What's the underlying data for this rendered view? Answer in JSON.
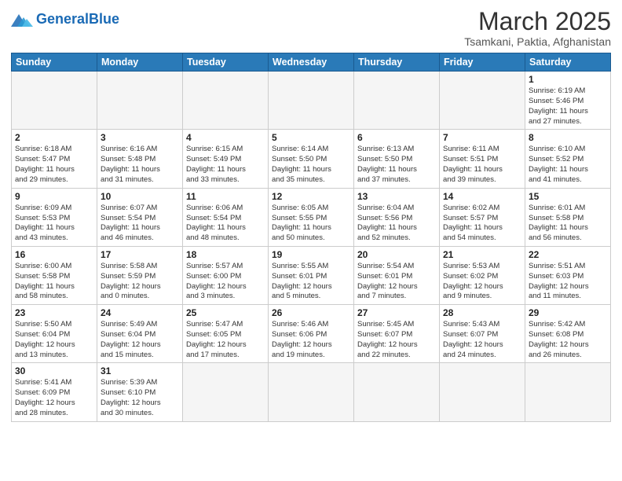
{
  "logo": {
    "general": "General",
    "blue": "Blue"
  },
  "header": {
    "month": "March 2025",
    "location": "Tsamkani, Paktia, Afghanistan"
  },
  "weekdays": [
    "Sunday",
    "Monday",
    "Tuesday",
    "Wednesday",
    "Thursday",
    "Friday",
    "Saturday"
  ],
  "weeks": [
    [
      {
        "day": "",
        "info": ""
      },
      {
        "day": "",
        "info": ""
      },
      {
        "day": "",
        "info": ""
      },
      {
        "day": "",
        "info": ""
      },
      {
        "day": "",
        "info": ""
      },
      {
        "day": "",
        "info": ""
      },
      {
        "day": "1",
        "info": "Sunrise: 6:19 AM\nSunset: 5:46 PM\nDaylight: 11 hours\nand 27 minutes."
      }
    ],
    [
      {
        "day": "2",
        "info": "Sunrise: 6:18 AM\nSunset: 5:47 PM\nDaylight: 11 hours\nand 29 minutes."
      },
      {
        "day": "3",
        "info": "Sunrise: 6:16 AM\nSunset: 5:48 PM\nDaylight: 11 hours\nand 31 minutes."
      },
      {
        "day": "4",
        "info": "Sunrise: 6:15 AM\nSunset: 5:49 PM\nDaylight: 11 hours\nand 33 minutes."
      },
      {
        "day": "5",
        "info": "Sunrise: 6:14 AM\nSunset: 5:50 PM\nDaylight: 11 hours\nand 35 minutes."
      },
      {
        "day": "6",
        "info": "Sunrise: 6:13 AM\nSunset: 5:50 PM\nDaylight: 11 hours\nand 37 minutes."
      },
      {
        "day": "7",
        "info": "Sunrise: 6:11 AM\nSunset: 5:51 PM\nDaylight: 11 hours\nand 39 minutes."
      },
      {
        "day": "8",
        "info": "Sunrise: 6:10 AM\nSunset: 5:52 PM\nDaylight: 11 hours\nand 41 minutes."
      }
    ],
    [
      {
        "day": "9",
        "info": "Sunrise: 6:09 AM\nSunset: 5:53 PM\nDaylight: 11 hours\nand 43 minutes."
      },
      {
        "day": "10",
        "info": "Sunrise: 6:07 AM\nSunset: 5:54 PM\nDaylight: 11 hours\nand 46 minutes."
      },
      {
        "day": "11",
        "info": "Sunrise: 6:06 AM\nSunset: 5:54 PM\nDaylight: 11 hours\nand 48 minutes."
      },
      {
        "day": "12",
        "info": "Sunrise: 6:05 AM\nSunset: 5:55 PM\nDaylight: 11 hours\nand 50 minutes."
      },
      {
        "day": "13",
        "info": "Sunrise: 6:04 AM\nSunset: 5:56 PM\nDaylight: 11 hours\nand 52 minutes."
      },
      {
        "day": "14",
        "info": "Sunrise: 6:02 AM\nSunset: 5:57 PM\nDaylight: 11 hours\nand 54 minutes."
      },
      {
        "day": "15",
        "info": "Sunrise: 6:01 AM\nSunset: 5:58 PM\nDaylight: 11 hours\nand 56 minutes."
      }
    ],
    [
      {
        "day": "16",
        "info": "Sunrise: 6:00 AM\nSunset: 5:58 PM\nDaylight: 11 hours\nand 58 minutes."
      },
      {
        "day": "17",
        "info": "Sunrise: 5:58 AM\nSunset: 5:59 PM\nDaylight: 12 hours\nand 0 minutes."
      },
      {
        "day": "18",
        "info": "Sunrise: 5:57 AM\nSunset: 6:00 PM\nDaylight: 12 hours\nand 3 minutes."
      },
      {
        "day": "19",
        "info": "Sunrise: 5:55 AM\nSunset: 6:01 PM\nDaylight: 12 hours\nand 5 minutes."
      },
      {
        "day": "20",
        "info": "Sunrise: 5:54 AM\nSunset: 6:01 PM\nDaylight: 12 hours\nand 7 minutes."
      },
      {
        "day": "21",
        "info": "Sunrise: 5:53 AM\nSunset: 6:02 PM\nDaylight: 12 hours\nand 9 minutes."
      },
      {
        "day": "22",
        "info": "Sunrise: 5:51 AM\nSunset: 6:03 PM\nDaylight: 12 hours\nand 11 minutes."
      }
    ],
    [
      {
        "day": "23",
        "info": "Sunrise: 5:50 AM\nSunset: 6:04 PM\nDaylight: 12 hours\nand 13 minutes."
      },
      {
        "day": "24",
        "info": "Sunrise: 5:49 AM\nSunset: 6:04 PM\nDaylight: 12 hours\nand 15 minutes."
      },
      {
        "day": "25",
        "info": "Sunrise: 5:47 AM\nSunset: 6:05 PM\nDaylight: 12 hours\nand 17 minutes."
      },
      {
        "day": "26",
        "info": "Sunrise: 5:46 AM\nSunset: 6:06 PM\nDaylight: 12 hours\nand 19 minutes."
      },
      {
        "day": "27",
        "info": "Sunrise: 5:45 AM\nSunset: 6:07 PM\nDaylight: 12 hours\nand 22 minutes."
      },
      {
        "day": "28",
        "info": "Sunrise: 5:43 AM\nSunset: 6:07 PM\nDaylight: 12 hours\nand 24 minutes."
      },
      {
        "day": "29",
        "info": "Sunrise: 5:42 AM\nSunset: 6:08 PM\nDaylight: 12 hours\nand 26 minutes."
      }
    ],
    [
      {
        "day": "30",
        "info": "Sunrise: 5:41 AM\nSunset: 6:09 PM\nDaylight: 12 hours\nand 28 minutes."
      },
      {
        "day": "31",
        "info": "Sunrise: 5:39 AM\nSunset: 6:10 PM\nDaylight: 12 hours\nand 30 minutes."
      },
      {
        "day": "",
        "info": ""
      },
      {
        "day": "",
        "info": ""
      },
      {
        "day": "",
        "info": ""
      },
      {
        "day": "",
        "info": ""
      },
      {
        "day": "",
        "info": ""
      }
    ]
  ]
}
